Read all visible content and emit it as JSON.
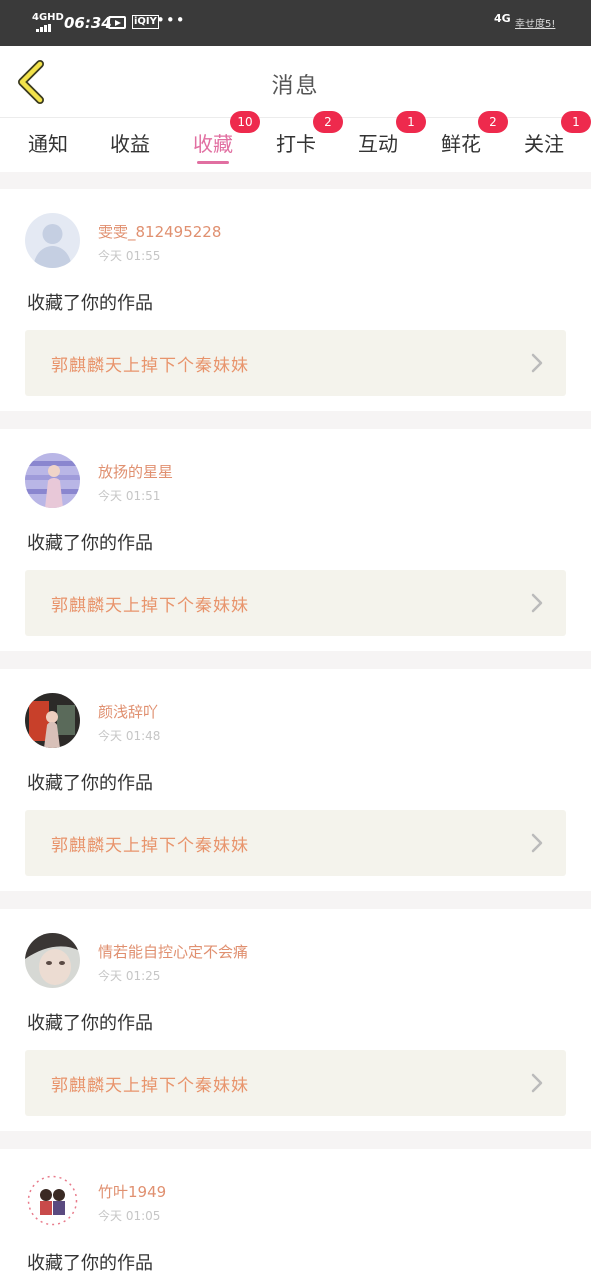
{
  "status_bar": {
    "network_left": "4GHD",
    "time": "06:34",
    "network_right": "4G",
    "right_text": "幸せ度5!"
  },
  "header": {
    "title": "消息"
  },
  "tabs": [
    {
      "label": "通知",
      "badge": ""
    },
    {
      "label": "收益",
      "badge": ""
    },
    {
      "label": "收藏",
      "badge": "10",
      "active": true
    },
    {
      "label": "打卡",
      "badge": "2"
    },
    {
      "label": "互动",
      "badge": "1"
    },
    {
      "label": "鲜花",
      "badge": "2"
    },
    {
      "label": "关注",
      "badge": "1"
    }
  ],
  "messages": [
    {
      "username": "雯雯_812495228",
      "time": "今天 01:55",
      "action": "收藏了你的作品",
      "work_title": "郭麒麟天上掉下个秦妹妹",
      "avatar": "default-avatar"
    },
    {
      "username": "放扬的星星",
      "time": "今天 01:51",
      "action": "收藏了你的作品",
      "work_title": "郭麒麟天上掉下个秦妹妹",
      "avatar": "user-photo"
    },
    {
      "username": "颜浅辞吖",
      "time": "今天 01:48",
      "action": "收藏了你的作品",
      "work_title": "郭麒麟天上掉下个秦妹妹",
      "avatar": "user-photo"
    },
    {
      "username": "情若能自控心定不会痛",
      "time": "今天 01:25",
      "action": "收藏了你的作品",
      "work_title": "郭麒麟天上掉下个秦妹妹",
      "avatar": "user-photo"
    },
    {
      "username": "竹叶1949",
      "time": "今天 01:05",
      "action": "收藏了你的作品",
      "work_title": "",
      "avatar": "user-photo"
    }
  ],
  "colors": {
    "accent_pink": "#e16fa1",
    "badge_red": "#ee2a4d",
    "username_orange": "#e09070",
    "work_title_orange": "#e8946c",
    "work_box_bg": "#f4f3ec",
    "back_arrow_yellow": "#f2e24a"
  }
}
